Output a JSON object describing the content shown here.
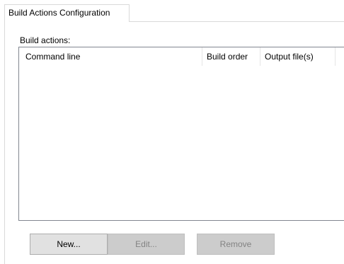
{
  "tabs": [
    {
      "label": "Build Actions Configuration",
      "selected": true
    }
  ],
  "build_actions": {
    "label": "Build actions:",
    "columns": [
      "Command line",
      "Build order",
      "Output file(s)"
    ],
    "rows": []
  },
  "buttons": {
    "new_label": "New...",
    "edit_label": "Edit...",
    "remove_label": "Remove"
  },
  "colors": {
    "border": "#d9d9d9",
    "list_border": "#828790",
    "button_enabled": "#e1e1e1",
    "button_disabled": "#cccccc",
    "disabled_text": "#838383"
  }
}
